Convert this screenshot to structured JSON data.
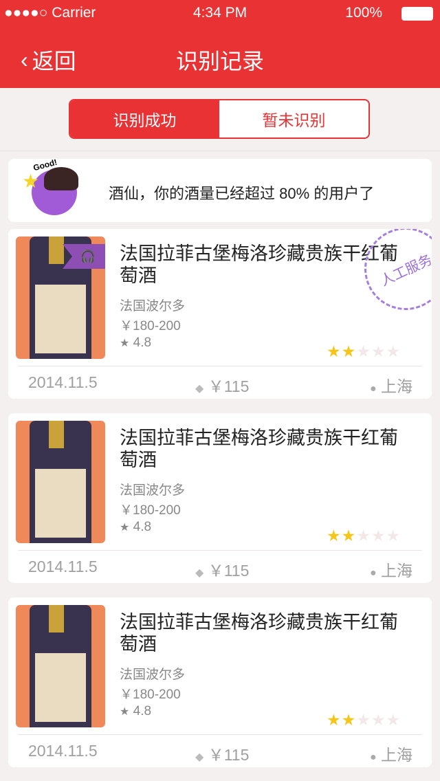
{
  "status": {
    "carrier": "●●●●○ Carrier",
    "time": "4:34 PM",
    "battery": "100%"
  },
  "nav": {
    "back": "返回",
    "title": "识别记录"
  },
  "tabs": [
    {
      "label": "识别成功",
      "active": true
    },
    {
      "label": "暂未识别",
      "active": false
    }
  ],
  "banner": {
    "badge": "Good!",
    "message": "酒仙，你的酒量已经超过 80% 的用户了"
  },
  "records": [
    {
      "title": "法国拉菲古堡梅洛珍藏贵族干红葡萄酒",
      "origin": "法国波尔多",
      "price_range": "￥180-200",
      "score": "4.8",
      "user_stars": 2,
      "max_stars": 5,
      "date": "2014.11.5",
      "paid": "￥115",
      "city": "上海",
      "stamp": "人工服务",
      "audio_badge": true
    },
    {
      "title": "法国拉菲古堡梅洛珍藏贵族干红葡萄酒",
      "origin": "法国波尔多",
      "price_range": "￥180-200",
      "score": "4.8",
      "user_stars": 2,
      "max_stars": 5,
      "date": "2014.11.5",
      "paid": "￥115",
      "city": "上海"
    },
    {
      "title": "法国拉菲古堡梅洛珍藏贵族干红葡萄酒",
      "origin": "法国波尔多",
      "price_range": "￥180-200",
      "score": "4.8",
      "user_stars": 2,
      "max_stars": 5,
      "date": "2014.11.5",
      "paid": "￥115",
      "city": "上海"
    }
  ]
}
